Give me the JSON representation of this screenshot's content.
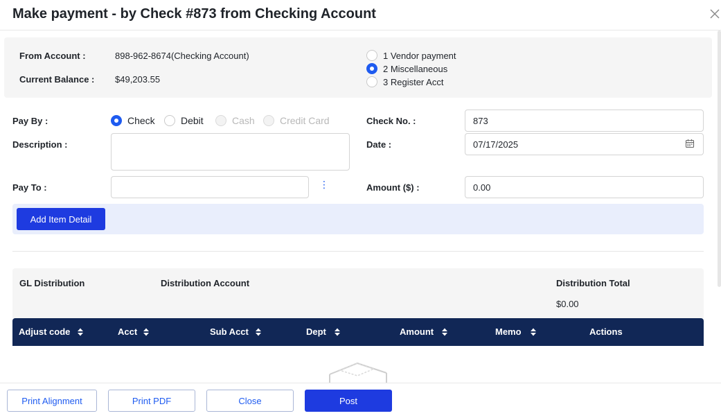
{
  "dialog": {
    "title": "Make payment - by Check #873 from Checking Account"
  },
  "account": {
    "from_label": "From Account :",
    "from_value": "898-962-8674(Checking Account)",
    "balance_label": "Current Balance :",
    "balance_value": "$49,203.55"
  },
  "payment_type": {
    "options": [
      "1 Vendor payment",
      "2 Miscellaneous",
      "3 Register Acct"
    ],
    "selected": "2 Miscellaneous"
  },
  "form": {
    "pay_by_label": "Pay By :",
    "pay_by_options": [
      "Check",
      "Debit",
      "Cash",
      "Credit Card"
    ],
    "pay_by_selected": "Check",
    "description_label": "Description :",
    "description_value": "",
    "pay_to_label": "Pay To :",
    "pay_to_value": "",
    "check_no_label": "Check No. :",
    "check_no_value": "873",
    "date_label": "Date :",
    "date_value": "07/17/2025",
    "amount_label": "Amount ($) :",
    "amount_value": "0.00"
  },
  "item_detail": {
    "button_label": "Add Item Detail"
  },
  "gl": {
    "distribution_label": "GL Distribution",
    "account_label": "Distribution Account",
    "total_label": "Distribution Total",
    "total_value": "$0.00"
  },
  "table": {
    "columns": [
      "Adjust code",
      "Acct",
      "Sub Acct",
      "Dept",
      "Amount",
      "Memo",
      "Actions"
    ]
  },
  "footer": {
    "print_alignment": "Print Alignment",
    "print_pdf": "Print PDF",
    "close": "Close",
    "post": "Post"
  },
  "colors": {
    "accent": "#1e5bf0",
    "primary_button": "#1e3be0",
    "table_header": "#112756",
    "panel_bg": "#f5f5f5",
    "item_bar_bg": "#e9eefc"
  },
  "icons": {
    "close": "close-icon",
    "calendar": "calendar-icon",
    "more": "kebab-menu-icon",
    "sort": "sort-icon",
    "empty": "empty-state-icon"
  }
}
